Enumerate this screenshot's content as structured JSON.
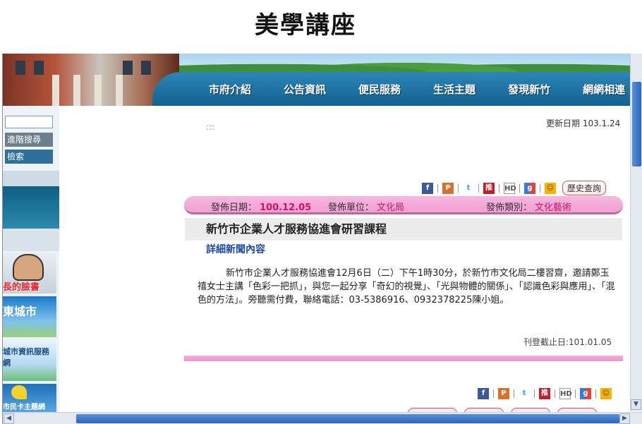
{
  "slide_title": "美學講座",
  "nav": {
    "items": [
      "市府介紹",
      "公告資訊",
      "便民服務",
      "生活主題",
      "發現新竹",
      "網網相連"
    ]
  },
  "sidebar": {
    "advanced_search": "進階搜尋",
    "search": "檢索",
    "banners": [
      "長的臉書",
      "東城市",
      "城市資訊服務網",
      "市民卡主題網"
    ]
  },
  "page": {
    "breadcrumb": ":::",
    "update_label": "更新日期",
    "update_value": "103.1.24",
    "history_button": "歷史查詢",
    "meta": {
      "publish_date_label": "發佈日期：",
      "publish_date": "100.12.05",
      "unit_label": "發佈單位：",
      "unit": "文化局",
      "category_label": "發佈類別：",
      "category": "文化藝術"
    },
    "news_title": "新竹市企業人才服務協進會研習課程",
    "detail_heading": "詳細新聞內容",
    "body": "新竹市企業人才服務協進會12月6日（二）下午1時30分，於新竹市文化局二樓習齋，邀請鄭玉禧女士主講「色彩一把抓」，與您一起分享「奇幻的視覺」、「光與物體的關係」、「認識色彩與應用」、「混色的方法」。旁聽需付費，聯絡電話：03-5386916、0932378225陳小姐。",
    "expire": "刊登截止日:101.01.05"
  },
  "colors": {
    "nav_blue": "#1b6fa3",
    "pink": "#f2a0d2",
    "meta_value": "#d0106d",
    "heading_blue": "#1d4aa6"
  }
}
